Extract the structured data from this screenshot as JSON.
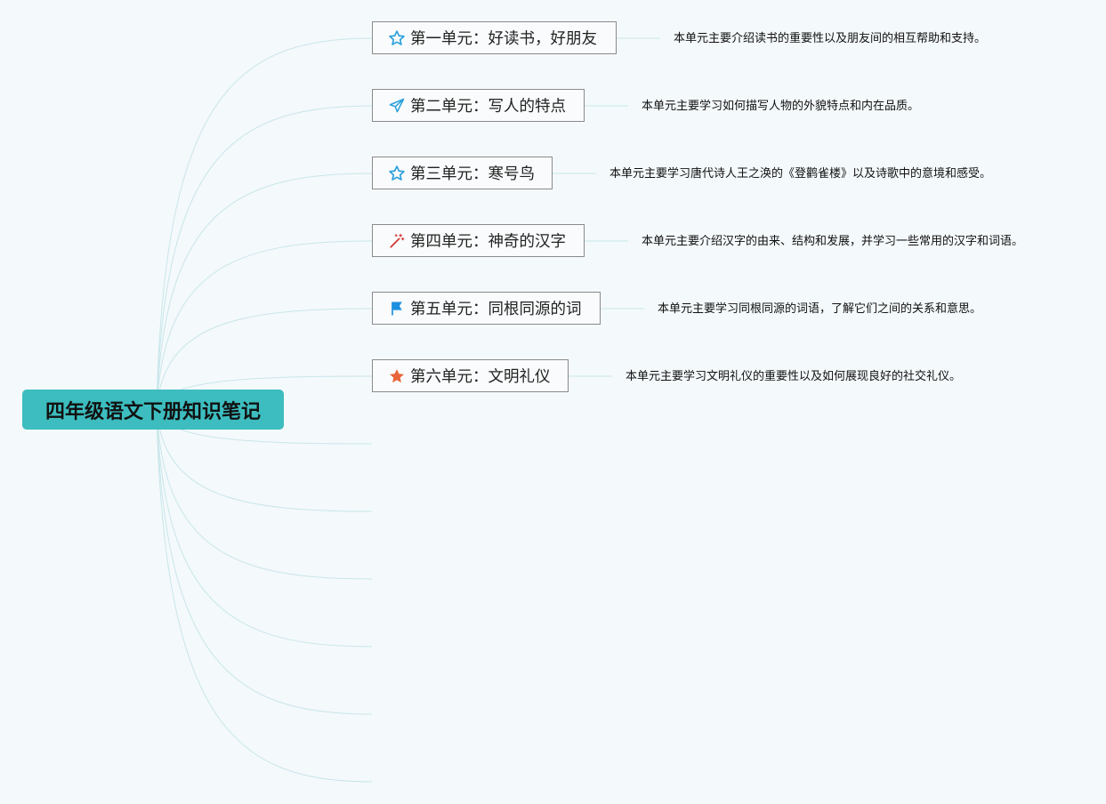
{
  "root": {
    "title": "四年级语文下册知识笔记"
  },
  "units": [
    {
      "title": "第一单元：好读书，好朋友",
      "icon": "star-outline-icon",
      "note": "本单元主要介绍读书的重要性以及朋友间的相互帮助和支持。"
    },
    {
      "title": "第二单元：写人的特点",
      "icon": "paper-plane-icon",
      "note": "本单元主要学习如何描写人物的外貌特点和内在品质。"
    },
    {
      "title": "第三单元：寒号鸟",
      "icon": "star-outline-icon",
      "note": "本单元主要学习唐代诗人王之涣的《登鹳雀楼》以及诗歌中的意境和感受。"
    },
    {
      "title": "第四单元：神奇的汉字",
      "icon": "magic-wand-icon",
      "note": "本单元主要介绍汉字的由来、结构和发展，并学习一些常用的汉字和词语。"
    },
    {
      "title": "第五单元：同根同源的词",
      "icon": "flag-icon",
      "note": "本单元主要学习同根同源的词语，了解它们之间的关系和意思。"
    },
    {
      "title": "第六单元：文明礼仪",
      "icon": "star-filled-icon",
      "note": "本单元主要学习文明礼仪的重要性以及如何展现良好的社交礼仪。"
    }
  ],
  "colors": {
    "root_fill": "#3dbdbf",
    "link_stroke": "#c8e6ea",
    "star_blue": "#2aa0dc",
    "star_orange": "#e8663a",
    "flag_blue": "#1c8fe0",
    "wand_red": "#d83a3a"
  }
}
